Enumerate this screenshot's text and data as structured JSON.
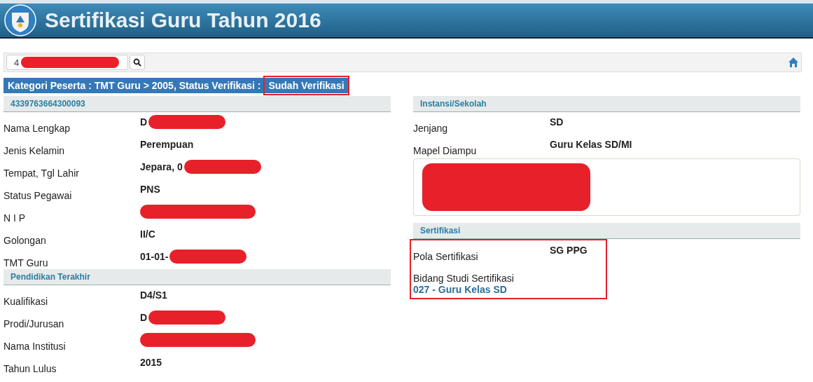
{
  "header": {
    "title": "Sertifikasi Guru Tahun 2016"
  },
  "search": {
    "value": "4",
    "redacted": true
  },
  "category": {
    "text": "Kategori Peserta : TMT Guru > 2005, Status Verifikasi :",
    "status": "Sudah Verifikasi",
    "highlighted": true
  },
  "left_sections": [
    {
      "title": "4339763664300093",
      "rows": [
        {
          "label": "Nama Lengkap",
          "value": "D",
          "redacted": true
        },
        {
          "label": "Jenis Kelamin",
          "value": "Perempuan"
        },
        {
          "label": "Tempat, Tgl Lahir",
          "value": "Jepara, 0",
          "redacted": true
        },
        {
          "label": "Status Pegawai",
          "value": "PNS"
        },
        {
          "label": "N I P",
          "redacted": true
        },
        {
          "label": "Golongan",
          "value": "II/C"
        },
        {
          "label": "TMT Guru",
          "value": "01-01-",
          "redacted": true
        }
      ]
    },
    {
      "title": "Pendidikan Terakhir",
      "rows": [
        {
          "label": "Kualifikasi",
          "value": "D4/S1"
        },
        {
          "label": "Prodi/Jurusan",
          "value": "D",
          "redacted": true
        },
        {
          "label": "Nama Institusi",
          "redacted": true
        },
        {
          "label": "Tahun Lulus",
          "value": "2015"
        }
      ]
    }
  ],
  "instansi": {
    "title": "Instansi/Sekolah",
    "rows": [
      {
        "label": "Jenjang",
        "value": "SD"
      },
      {
        "label": "Mapel Diampu",
        "value": "Guru Kelas SD/MI"
      }
    ],
    "address_redacted": true
  },
  "sertifikasi": {
    "title": "Sertifikasi",
    "highlighted": true,
    "rows": [
      {
        "label": "Pola Sertifikasi",
        "value": "SG PPG"
      }
    ],
    "bidang_label": "Bidang Studi Sertifikasi",
    "bidang_value": "027 - Guru Kelas SD"
  }
}
